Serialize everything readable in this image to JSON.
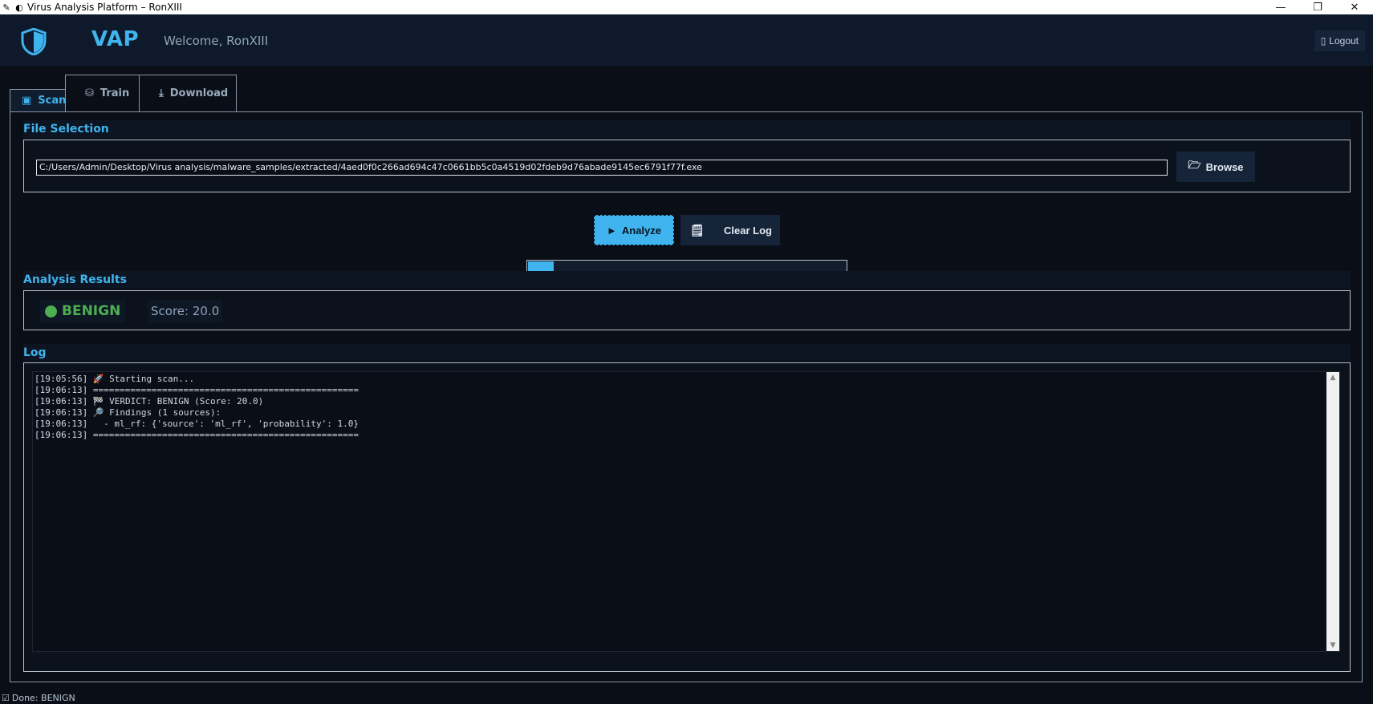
{
  "window": {
    "title": "Virus Analysis Platform – RonXIII",
    "controls": {
      "minimize": "—",
      "maximize": "❐",
      "close": "✕"
    },
    "app_icon_glyphs": [
      "✎",
      "◐"
    ]
  },
  "header": {
    "logo_icon": "shield-icon",
    "brand": "VAP",
    "welcome": "Welcome, RonXIII",
    "logout_icon": "▯",
    "logout_label": "Logout"
  },
  "tabs": [
    {
      "label": "Scan",
      "icon": "▣",
      "active": true
    },
    {
      "label": "Train",
      "icon": "⛁",
      "active": false
    },
    {
      "label": "Download",
      "icon": "⤓",
      "active": false
    }
  ],
  "file_selection": {
    "title": "File Selection",
    "path": "C:/Users/Admin/Desktop/Virus analysis/malware_samples/extracted/4aed0f0c266ad694c47c0661bb5c0a4519d02fdeb9d76abade9145ec6791f77f.exe",
    "browse_icon": "🗁",
    "browse_label": "Browse"
  },
  "actions": {
    "analyze_icon": "►",
    "analyze_label": "Analyze",
    "clear_icon": "🗒",
    "clear_label": "Clear Log"
  },
  "progress": {
    "value": 0.08
  },
  "results": {
    "title": "Analysis Results",
    "verdict": "BENIGN",
    "verdict_color": "#4caf50",
    "score_text": "Score: 20.0"
  },
  "log": {
    "title": "Log",
    "lines": [
      "[19:05:56] 🚀 Starting scan...",
      "[19:06:13] ==================================================",
      "[19:06:13] 🏁 VERDICT: BENIGN (Score: 20.0)",
      "[19:06:13] 🔎 Findings (1 sources):",
      "[19:06:13]   - ml_rf: {'source': 'ml_rf', 'probability': 1.0}",
      "[19:06:13] =================================================="
    ]
  },
  "status": {
    "icon": "☑",
    "text": "Done: BENIGN"
  },
  "colors": {
    "accent": "#3fb4ee",
    "background": "#0a0f17",
    "header": "#0e1a2b",
    "benign": "#4caf50"
  }
}
